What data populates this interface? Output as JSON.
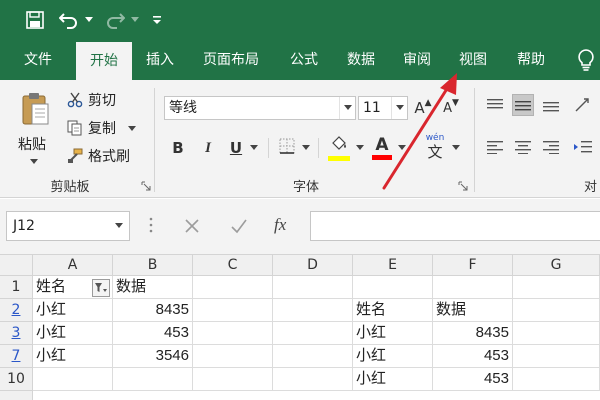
{
  "ribbon_tabs": [
    "文件",
    "开始",
    "插入",
    "页面布局",
    "公式",
    "数据",
    "审阅",
    "视图",
    "帮助"
  ],
  "active_tab": "开始",
  "clipboard": {
    "paste_label": "粘贴",
    "cut_label": "剪切",
    "copy_label": "复制",
    "format_painter_label": "格式刷",
    "group_label": "剪贴板"
  },
  "font": {
    "font_name": "等线",
    "font_size": "11",
    "bold": "B",
    "italic": "I",
    "underline": "U",
    "font_color_glyph": "A",
    "phonetic_top": "wén",
    "phonetic_bottom": "文",
    "grow_glyph": "A",
    "shrink_glyph": "A",
    "group_label": "字体",
    "fill_color": "#ffff00",
    "font_color": "#ff0000"
  },
  "alignment": {
    "partial_label": "对"
  },
  "formula_bar": {
    "name_box": "J12",
    "fx_label": "fx",
    "formula": ""
  },
  "columns": [
    "A",
    "B",
    "C",
    "D",
    "E",
    "F",
    "G"
  ],
  "rows": [
    {
      "header": "1",
      "filtered": false,
      "cells": [
        "姓名",
        "数据",
        "",
        "",
        "",
        "",
        ""
      ]
    },
    {
      "header": "2",
      "filtered": true,
      "cells": [
        "小红",
        "8435",
        "",
        "",
        "姓名",
        "数据",
        ""
      ]
    },
    {
      "header": "3",
      "filtered": true,
      "cells": [
        "小红",
        "453",
        "",
        "",
        "小红",
        "8435",
        ""
      ]
    },
    {
      "header": "7",
      "filtered": true,
      "cells": [
        "小红",
        "3546",
        "",
        "",
        "小红",
        "453",
        ""
      ]
    },
    {
      "header": "10",
      "filtered": false,
      "cells": [
        "",
        "",
        "",
        "",
        "小红",
        "453",
        ""
      ]
    }
  ],
  "colors": {
    "excel_green": "#217346",
    "arrow_red": "#d9262e",
    "filtered_row_blue": "#2b57c8"
  },
  "icons": {
    "quick_access": [
      "save-icon",
      "undo-icon",
      "redo-icon",
      "customize-icon"
    ],
    "tell_me": "lightbulb-icon",
    "filter": "filter-icon"
  }
}
